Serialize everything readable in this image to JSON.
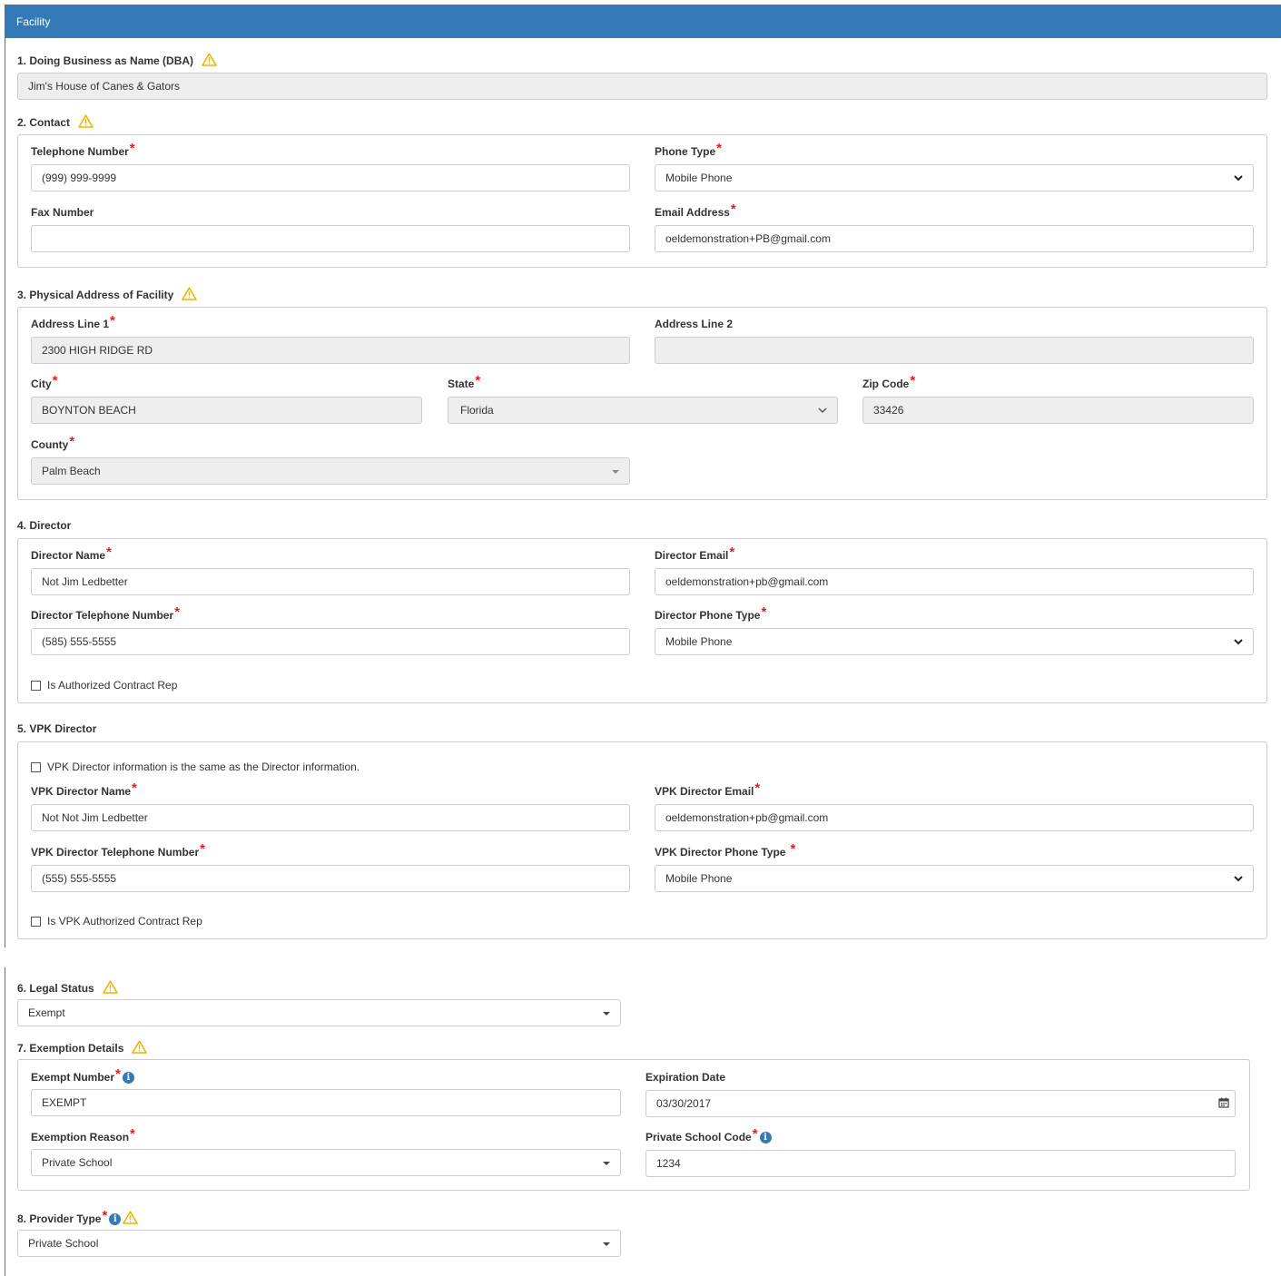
{
  "header": {
    "title": "Facility"
  },
  "sections": {
    "dba": "1. Doing Business as Name (DBA)",
    "contact": "2. Contact",
    "physical": "3. Physical Address of Facility",
    "director": "4. Director",
    "vpk": "5. VPK Director",
    "legal": "6. Legal Status",
    "exemption": "7. Exemption Details",
    "provider": "8. Provider Type"
  },
  "dba": {
    "value": "Jim's House of Canes & Gators"
  },
  "contact": {
    "phone_label": "Telephone Number",
    "phone_value": "(999) 999-9999",
    "phone_type_label": "Phone Type",
    "phone_type_value": "Mobile Phone",
    "fax_label": "Fax Number",
    "fax_value": "",
    "email_label": "Email Address",
    "email_value": "oeldemonstration+PB@gmail.com"
  },
  "address": {
    "line1_label": "Address Line 1",
    "line1_value": "2300 HIGH RIDGE RD",
    "line2_label": "Address Line 2",
    "line2_value": "",
    "city_label": "City",
    "city_value": "BOYNTON BEACH",
    "state_label": "State",
    "state_value": "Florida",
    "zip_label": "Zip Code",
    "zip_value": "33426",
    "county_label": "County",
    "county_value": "Palm Beach"
  },
  "director": {
    "name_label": "Director Name",
    "name_value": "Not Jim Ledbetter",
    "email_label": "Director Email",
    "email_value": "oeldemonstration+pb@gmail.com",
    "phone_label": "Director Telephone Number",
    "phone_value": "(585) 555-5555",
    "phone_type_label": "Director Phone Type",
    "phone_type_value": "Mobile Phone",
    "auth_label": "Is Authorized Contract Rep"
  },
  "vpk": {
    "same_label": "VPK Director information is the same as the Director information.",
    "name_label": "VPK Director Name",
    "name_value": "Not Not Jim Ledbetter",
    "email_label": "VPK Director Email",
    "email_value": "oeldemonstration+pb@gmail.com",
    "phone_label": "VPK Director Telephone Number",
    "phone_value": "(555) 555-5555",
    "phone_type_label": "VPK Director Phone Type",
    "phone_type_value": "Mobile Phone",
    "auth_label": "Is VPK Authorized Contract Rep"
  },
  "legal": {
    "value": "Exempt"
  },
  "exemption": {
    "number_label": "Exempt Number",
    "number_value": "EXEMPT",
    "expiration_label": "Expiration Date",
    "expiration_value": "03/30/2017",
    "reason_label": "Exemption Reason",
    "reason_value": "Private School",
    "school_code_label": "Private School Code",
    "school_code_value": "1234"
  },
  "provider": {
    "value": "Private School"
  },
  "colors": {
    "header": "#337ab7",
    "required": "#e02020",
    "warning": "#f0b400",
    "info": "#337ab7",
    "readonly": "#eeeeee"
  }
}
